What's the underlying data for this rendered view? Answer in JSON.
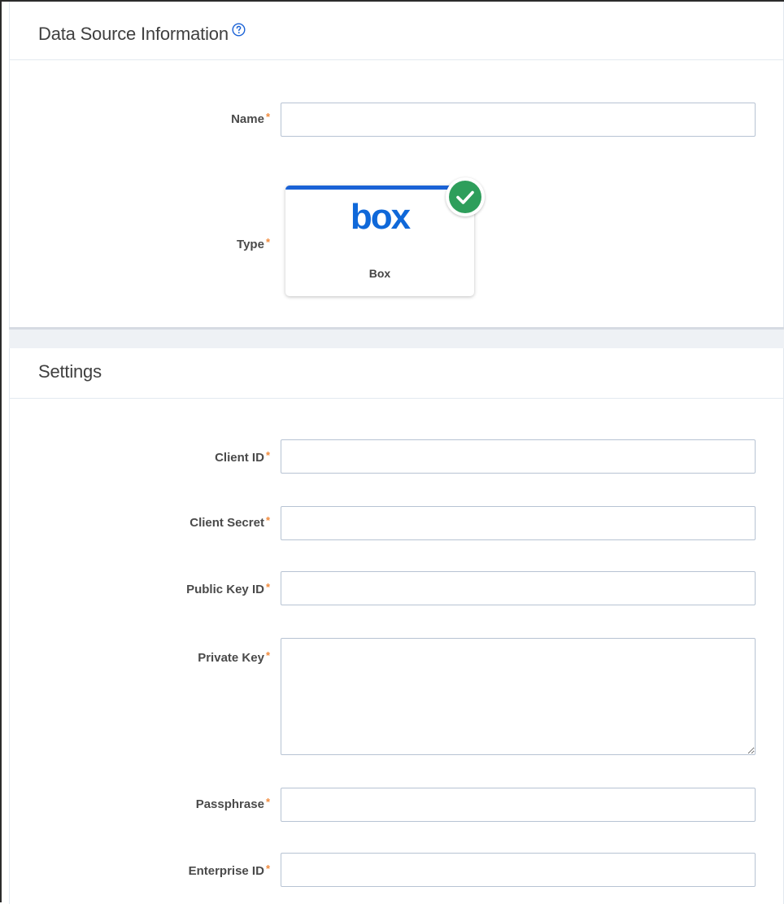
{
  "data_source": {
    "title": "Data Source Information",
    "help_icon": "question-circle-icon",
    "name_label": "Name",
    "name_value": "",
    "type_label": "Type",
    "type_card": {
      "logo_text": "box",
      "name": "Box",
      "selected": true,
      "accent_color": "#1a62d6",
      "check_color": "#2e9e5b"
    }
  },
  "settings": {
    "title": "Settings",
    "fields": [
      {
        "label": "Client ID",
        "value": ""
      },
      {
        "label": "Client Secret",
        "value": ""
      },
      {
        "label": "Public Key ID",
        "value": ""
      },
      {
        "label": "Private Key",
        "value": ""
      },
      {
        "label": "Passphrase",
        "value": ""
      },
      {
        "label": "Enterprise ID",
        "value": ""
      }
    ]
  },
  "required_marker": "*",
  "colors": {
    "required": "#f08a3c",
    "input_border": "#b7c3d3",
    "logo": "#0f68d9"
  }
}
